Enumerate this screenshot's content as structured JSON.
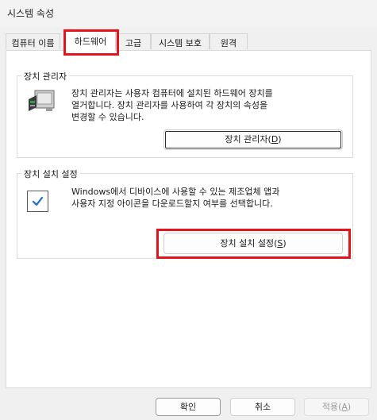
{
  "window": {
    "title": "시스템 속성"
  },
  "tabs": [
    {
      "label": "컴퓨터 이름",
      "active": false
    },
    {
      "label": "하드웨어",
      "active": true
    },
    {
      "label": "고급",
      "active": false
    },
    {
      "label": "시스템 보호",
      "active": false
    },
    {
      "label": "원격",
      "active": false
    }
  ],
  "device_manager": {
    "legend": "장치 관리자",
    "description_line1": "장치 관리자는 사용자 컴퓨터에 설치된 하드웨어 장치를",
    "description_line2": "열거합니다. 장치 관리자를 사용하여 각 장치의 속성을",
    "description_line3": "변경할 수 있습니다.",
    "button_label": "장치 관리자",
    "button_mnemonic": "D",
    "icon": "device-manager-icon"
  },
  "device_install": {
    "legend": "장치 설치 설정",
    "description_line1": "Windows에서 디바이스에 사용할 수 있는 제조업체 앱과",
    "description_line2": "사용자 지정 아이콘을 다운로드할지 여부를 선택합니다.",
    "button_label": "장치 설치 설정",
    "button_mnemonic": "S",
    "icon": "checkmark-icon"
  },
  "footer": {
    "ok_label": "확인",
    "cancel_label": "취소",
    "apply_label": "적용",
    "apply_mnemonic": "A"
  },
  "colors": {
    "highlight": "#e3141b",
    "check": "#1f6fc6"
  }
}
